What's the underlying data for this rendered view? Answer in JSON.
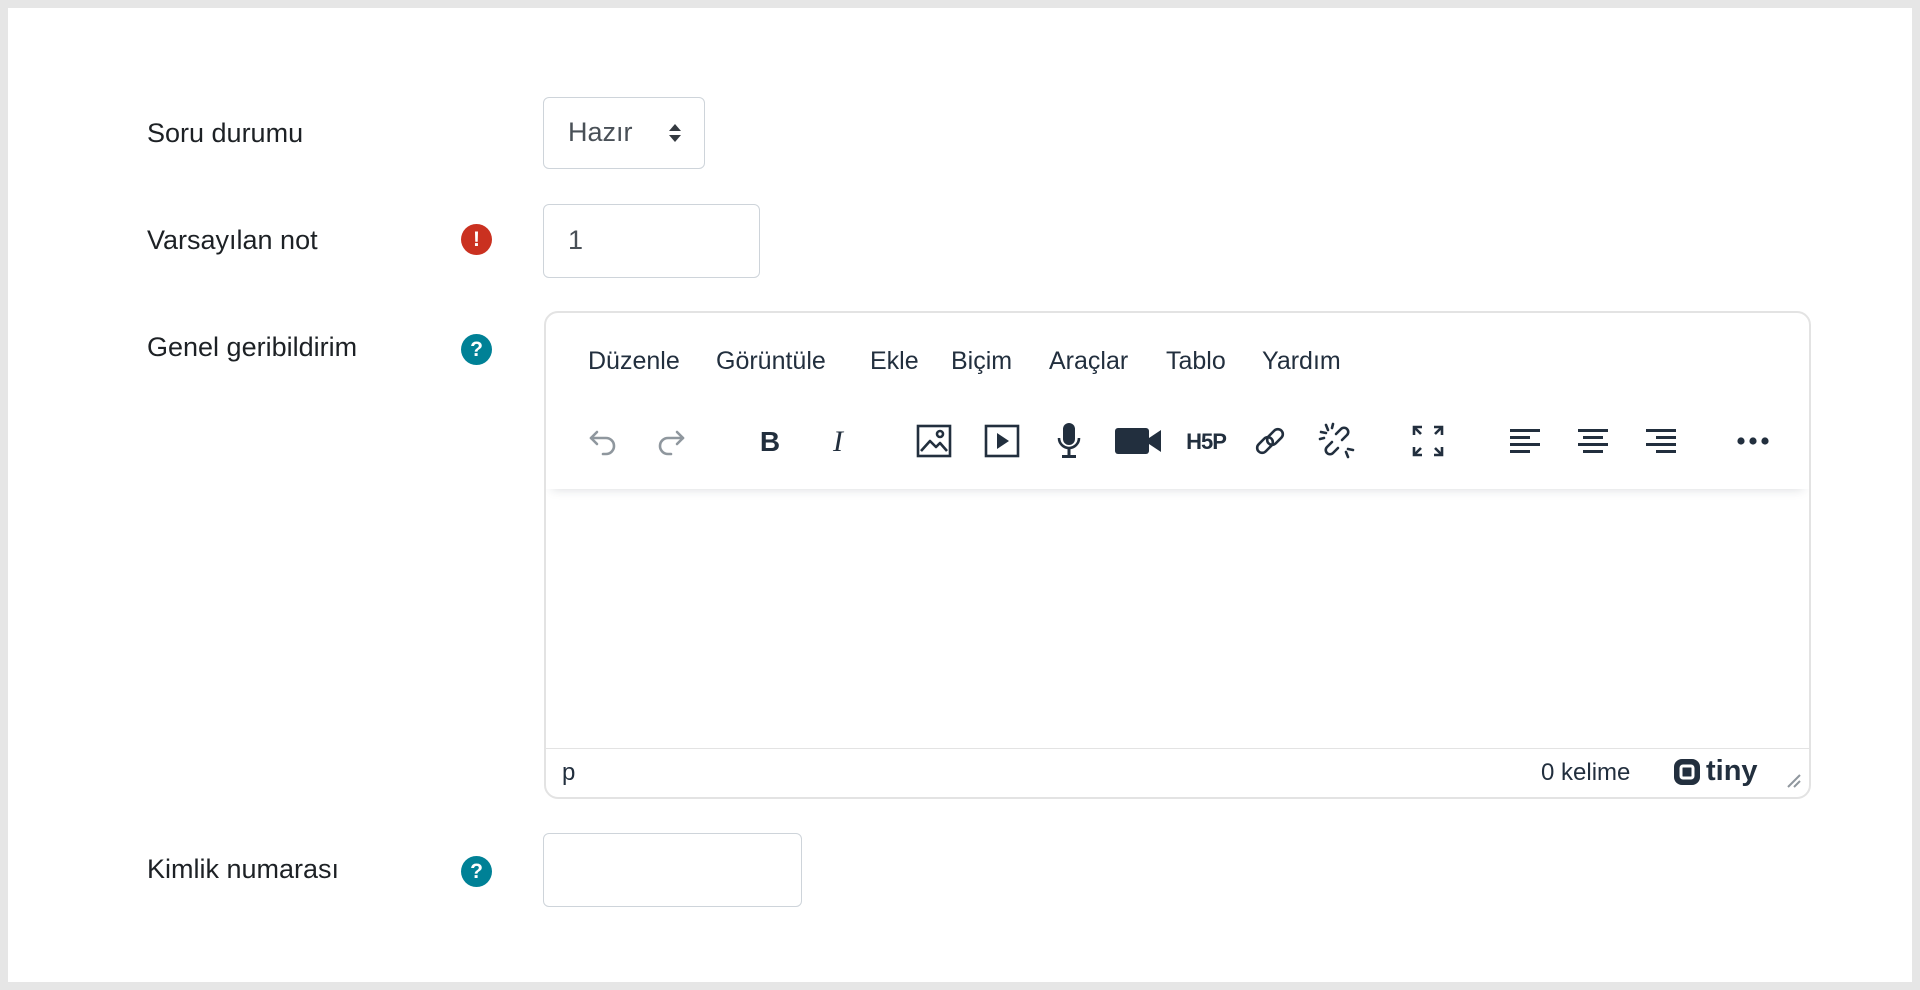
{
  "form": {
    "status": {
      "label": "Soru durumu",
      "value": "Hazır"
    },
    "default_mark": {
      "label": "Varsayılan not",
      "value": "1",
      "badge": "!"
    },
    "general_feedback": {
      "label": "Genel geribildirim",
      "badge": "?"
    },
    "id_number": {
      "label": "Kimlik numarası",
      "value": "",
      "badge": "?"
    }
  },
  "editor": {
    "menus": [
      "Düzenle",
      "Görüntüle",
      "Ekle",
      "Biçim",
      "Araçlar",
      "Tablo",
      "Yardım"
    ],
    "toolbar_icons": [
      "undo-icon",
      "redo-icon",
      "bold-icon",
      "italic-icon",
      "image-icon",
      "media-icon",
      "microphone-icon",
      "video-camera-icon",
      "h5p-icon",
      "link-icon",
      "unlink-icon",
      "fullscreen-icon",
      "align-left-icon",
      "align-center-icon",
      "align-right-icon",
      "more-icon"
    ],
    "content": "",
    "status": {
      "path": "p",
      "word_count": "0 kelime",
      "brand": "tiny"
    }
  },
  "colors": {
    "error": "#ca3120",
    "help": "#008196",
    "border": "#ced4da"
  }
}
